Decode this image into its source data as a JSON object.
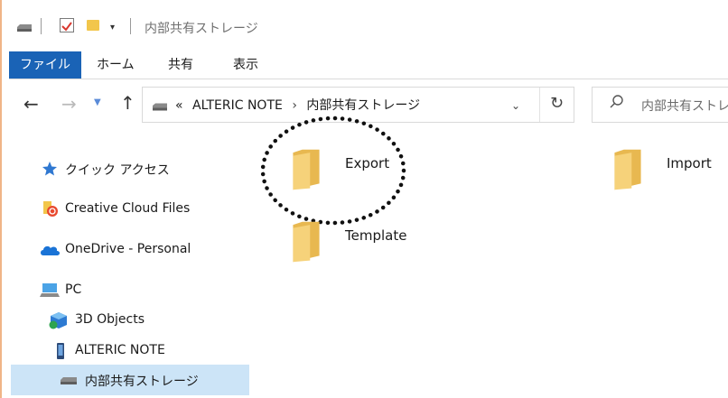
{
  "titlebar": {
    "title": "内部共有ストレージ"
  },
  "ribbon": {
    "tabs": [
      "ファイル",
      "ホーム",
      "共有",
      "表示"
    ],
    "accent": "#1a63b6"
  },
  "address_bar": {
    "prefix": "«",
    "path": [
      "ALTERIC NOTE",
      "内部共有ストレージ"
    ],
    "separator": "›"
  },
  "search": {
    "placeholder": "内部共有ストレ"
  },
  "sidebar": {
    "items": [
      {
        "label": "クイック アクセス",
        "icon": "star-icon"
      },
      {
        "label": "Creative Cloud Files",
        "icon": "creative-cloud-icon"
      },
      {
        "label": "OneDrive - Personal",
        "icon": "onedrive-cloud-icon"
      },
      {
        "label": "PC",
        "icon": "pc-icon"
      },
      {
        "label": "3D Objects",
        "icon": "3d-objects-icon"
      },
      {
        "label": "ALTERIC NOTE",
        "icon": "device-icon"
      },
      {
        "label": "内部共有ストレージ",
        "icon": "storage-drive-icon",
        "selected": true
      }
    ]
  },
  "folders": [
    {
      "name": "Export",
      "highlighted": true
    },
    {
      "name": "Import"
    },
    {
      "name": "Template"
    }
  ],
  "colors": {
    "folder": "#f5cd67",
    "selection": "#cce4f7",
    "accent_left_border": "#e8a86a"
  }
}
